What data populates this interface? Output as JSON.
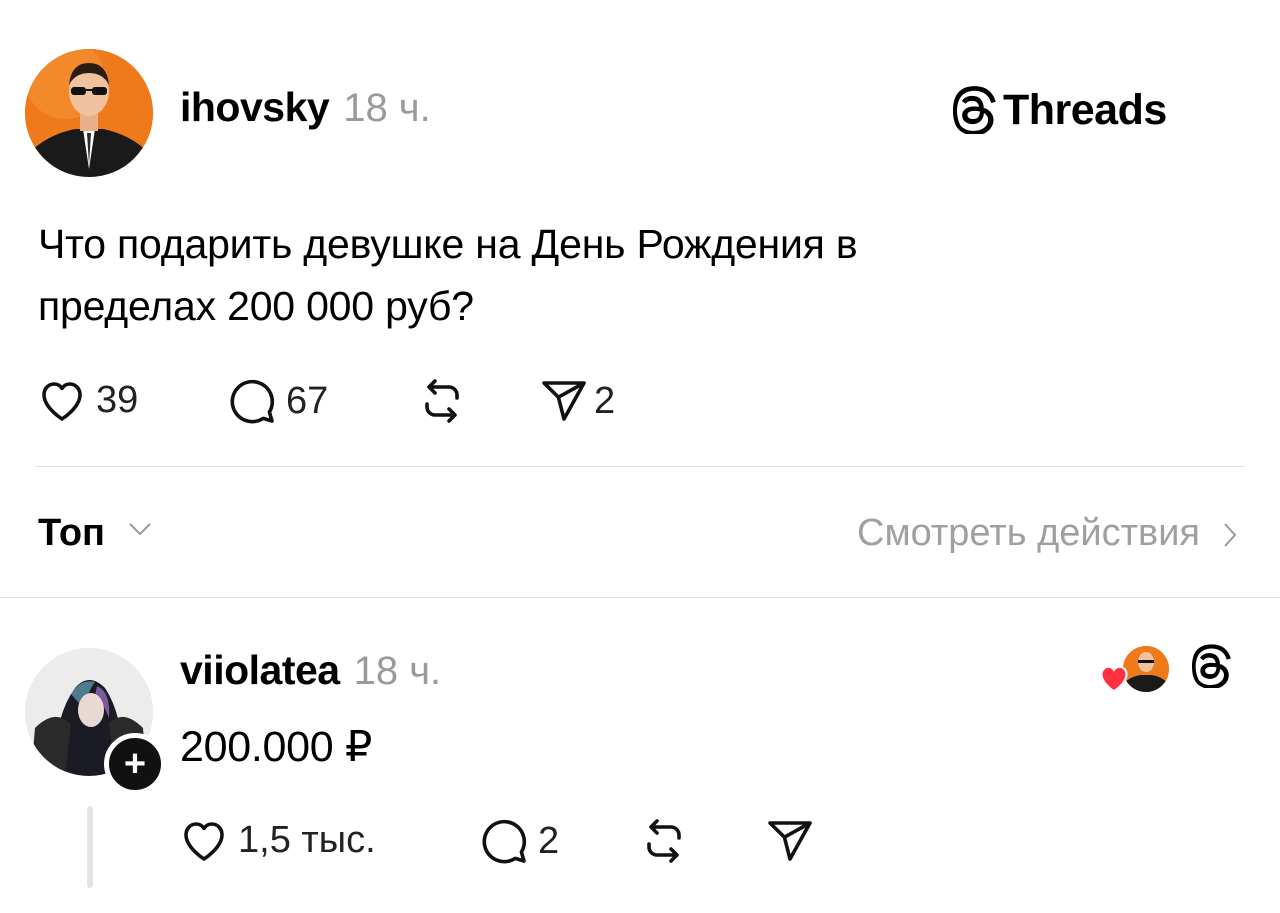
{
  "post": {
    "username": "ihovsky",
    "time": "18 ч.",
    "brand": "Threads",
    "text_line1": "Что подарить девушке на День Рождения в",
    "text_line2": "пределах 200 000 руб?",
    "actions": {
      "likes": "39",
      "comments": "67",
      "shares": "2"
    }
  },
  "sort": {
    "label": "Топ",
    "activity_link": "Смотреть действия"
  },
  "reply": {
    "username": "viiolatea",
    "time": "18 ч.",
    "text": "200.000 ₽",
    "follow_badge": "+",
    "actions": {
      "likes": "1,5 тыс.",
      "comments": "2"
    }
  },
  "colors": {
    "accent_orange": "#ef7a1c",
    "heart_red": "#ff3040",
    "muted_text": "#9a9a9a"
  },
  "icons": [
    "threads-logo-icon",
    "heart-icon",
    "comment-icon",
    "repost-icon",
    "share-icon",
    "chevron-down-icon",
    "chevron-right-icon",
    "plus-icon"
  ]
}
